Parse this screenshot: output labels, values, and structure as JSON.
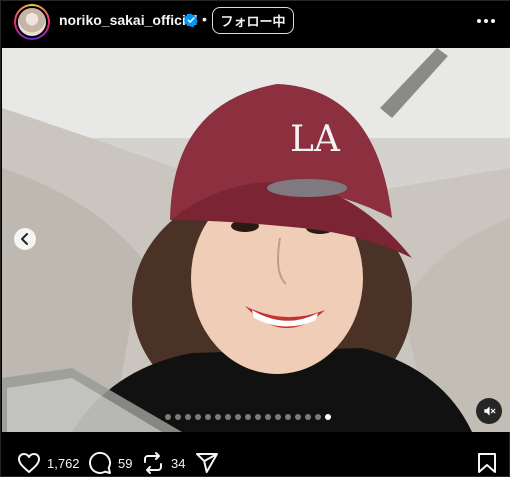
{
  "header": {
    "username": "noriko_sakai_official",
    "separator": "•",
    "follow_label": "フォロー中",
    "avatar_icon": "profile-avatar",
    "verified_icon": "verified-badge-icon",
    "more_icon": "more-options-icon"
  },
  "media": {
    "cap_logo": "LA",
    "carousel": {
      "total": 17,
      "active_index": 16
    },
    "prev_icon": "chevron-left-icon",
    "mute_icon": "muted-speaker-icon"
  },
  "actions": {
    "like_count": "1,762",
    "comment_count": "59",
    "repost_count": "34",
    "icons": [
      "heart-icon",
      "comment-icon",
      "repost-icon",
      "share-icon",
      "bookmark-icon"
    ]
  },
  "colors": {
    "background": "#000000",
    "text": "#f5f5f5",
    "verified": "#0095f6",
    "cap": "#8c2f3f"
  }
}
